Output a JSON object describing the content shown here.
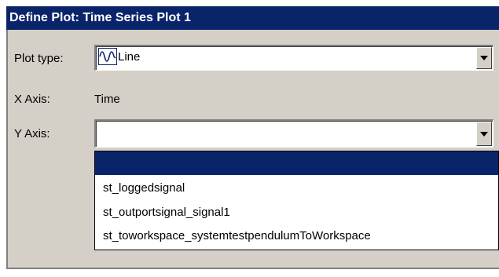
{
  "dialog": {
    "title": "Define Plot: Time Series Plot 1"
  },
  "plot_type": {
    "label": "Plot type:",
    "value": "Line",
    "icon": "line-plot-icon"
  },
  "x_axis": {
    "label": "X Axis:",
    "value": "Time"
  },
  "y_axis": {
    "label": "Y Axis:",
    "value": "",
    "options": [
      "",
      "st_loggedsignal",
      "st_outportsignal_signal1",
      "st_toworkspace_systemtestpendulumToWorkspace"
    ],
    "highlighted_index": 0
  },
  "colors": {
    "title_bar": "#0a246a",
    "panel": "#d4d0c8",
    "selection": "#0a246a"
  }
}
